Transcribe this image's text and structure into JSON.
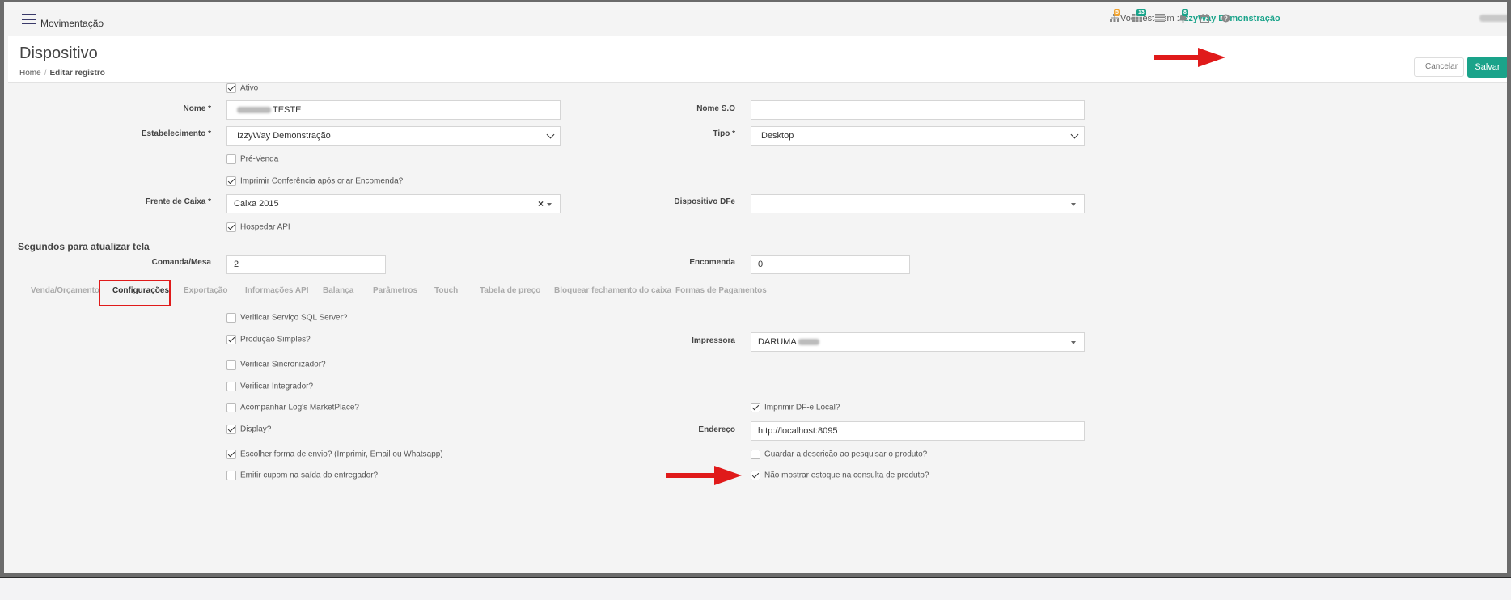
{
  "nav": {
    "title": "Movimentação",
    "env_prefix": "Você está em : ",
    "establishment": "IzzyWay Demonstração",
    "badges": {
      "sitemap": "5",
      "grid": "13",
      "bell": "8"
    }
  },
  "header": {
    "title": "Dispositivo",
    "breadcrumb": {
      "home": "Home",
      "current": "Editar registro"
    },
    "cancel_label": "Cancelar",
    "save_label": "Salvar"
  },
  "form": {
    "ativo": {
      "label": "Ativo",
      "checked": true
    },
    "nome": {
      "label": "Nome *",
      "value": "TESTE"
    },
    "nome_so": {
      "label": "Nome S.O",
      "value": ""
    },
    "estabelecimento": {
      "label": "Estabelecimento *",
      "value": "IzzyWay Demonstração"
    },
    "tipo": {
      "label": "Tipo *",
      "value": "Desktop"
    },
    "pre_venda": {
      "label": "Pré-Venda",
      "checked": false
    },
    "imprimir_conferencia": {
      "label": "Imprimir Conferência após criar Encomenda?",
      "checked": true
    },
    "frente_caixa": {
      "label": "Frente de Caixa *",
      "value": "Caixa 2015",
      "clear": "×"
    },
    "dispositivo_dfe": {
      "label": "Dispositivo DFe",
      "value": ""
    },
    "hospedar_api": {
      "label": "Hospedar API",
      "checked": true
    }
  },
  "refresh": {
    "title": "Segundos para atualizar tela",
    "comanda": {
      "label": "Comanda/Mesa",
      "value": "2"
    },
    "encomenda": {
      "label": "Encomenda",
      "value": "0"
    }
  },
  "tabs": [
    {
      "label": "Venda/Orçamento",
      "active": false
    },
    {
      "label": "Configurações",
      "active": true
    },
    {
      "label": "Exportação",
      "active": false
    },
    {
      "label": "Informações API",
      "active": false
    },
    {
      "label": "Balança",
      "active": false
    },
    {
      "label": "Parâmetros",
      "active": false
    },
    {
      "label": "Touch",
      "active": false
    },
    {
      "label": "Tabela de preço",
      "active": false
    },
    {
      "label": "Bloquear fechamento do caixa",
      "active": false
    },
    {
      "label": "Formas de Pagamentos",
      "active": false
    }
  ],
  "config": {
    "verificar_sql": {
      "label": "Verificar Serviço SQL Server?",
      "checked": false
    },
    "producao_simples": {
      "label": "Produção Simples?",
      "checked": true
    },
    "impressora": {
      "label": "Impressora",
      "value": "DARUMA"
    },
    "verificar_sinc": {
      "label": "Verificar Sincronizador?",
      "checked": false
    },
    "verificar_integ": {
      "label": "Verificar Integrador?",
      "checked": false
    },
    "acompanhar_log": {
      "label": "Acompanhar Log's MarketPlace?",
      "checked": false
    },
    "imprimir_dfe": {
      "label": "Imprimir DF-e Local?",
      "checked": true
    },
    "display": {
      "label": "Display?",
      "checked": true
    },
    "endereco": {
      "label": "Endereço",
      "value": "http://localhost:8095"
    },
    "escolher_envio": {
      "label": "Escolher forma de envio? (Imprimir, Email ou Whatsapp)",
      "checked": true
    },
    "guardar_descricao": {
      "label": "Guardar a descrição ao pesquisar o produto?",
      "checked": false
    },
    "emitir_cupom": {
      "label": "Emitir cupom na saída do entregador?",
      "checked": false
    },
    "nao_mostrar_estoque": {
      "label": "Não mostrar estoque na consulta de produto?",
      "checked": true
    }
  },
  "colors": {
    "accent": "#1aa38a",
    "annotation": "#e01a1a"
  }
}
